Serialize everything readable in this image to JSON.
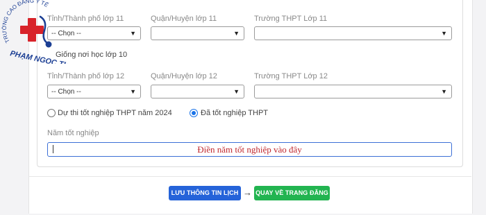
{
  "logo": {
    "arc_text": "TRƯỜNG CAO ĐẲNG Y TẾ",
    "bottom_text": "PHẠM NGỌC THẠCH"
  },
  "grade11": {
    "province_label": "Tỉnh/Thành phố lớp 11",
    "district_label": "Quận/Huyện lớp 11",
    "school_label": "Trường THPT Lớp 11",
    "province_value": "-- Chọn --",
    "district_value": "",
    "school_value": ""
  },
  "same_as_grade10": {
    "label": "Giống nơi học lớp 10"
  },
  "grade12": {
    "province_label": "Tỉnh/Thành phố lớp 12",
    "district_label": "Quận/Huyện lớp 12",
    "school_label": "Trường THPT Lớp 12",
    "province_value": "-- Chọn --",
    "district_value": "",
    "school_value": ""
  },
  "exam_status": {
    "option1": "Dự thi tốt nghiệp THPT năm 2024",
    "option2": "Đã tốt nghiệp THPT",
    "selected": "option2"
  },
  "graduation_year": {
    "label": "Năm tốt nghiệp",
    "value": "",
    "hint": "Điền năm tốt nghiệp vào đây"
  },
  "actions": {
    "save_label": "LƯU THÔNG TIN LỊCH SỬ",
    "back_label": "QUAY VỀ TRANG ĐĂNG KÝ"
  },
  "colors": {
    "accent": "#2563d9",
    "success": "#22b450",
    "hint_red": "#c0272d",
    "logo_blue": "#1c3f94",
    "logo_red": "#d8232a"
  }
}
